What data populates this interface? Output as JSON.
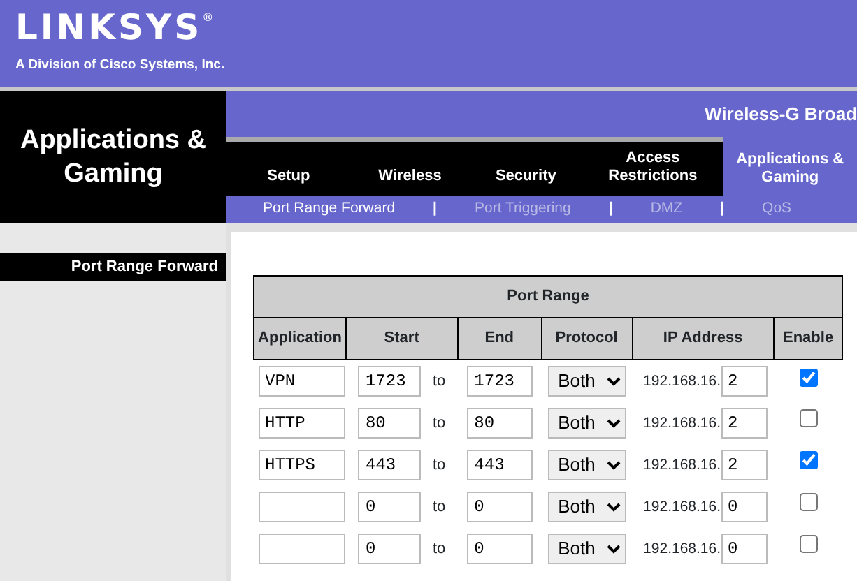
{
  "logo": {
    "wordmark": "LINKSYS",
    "registered": "®",
    "tagline": "A Division of Cisco Systems, Inc."
  },
  "section_title": "Applications & Gaming",
  "product_name": "Wireless-G Broad",
  "tabs": [
    {
      "label": "Setup",
      "selected": false
    },
    {
      "label": "Wireless",
      "selected": false
    },
    {
      "label": "Security",
      "selected": false
    },
    {
      "label": "Access Restrictions",
      "selected": false
    },
    {
      "label": "Applications & Gaming",
      "selected": true
    }
  ],
  "subtabs": [
    {
      "label": "Port Range Forward",
      "selected": true
    },
    {
      "label": "Port Triggering",
      "selected": false
    },
    {
      "label": "DMZ",
      "selected": false
    },
    {
      "label": "QoS",
      "selected": false
    }
  ],
  "separator": "|",
  "sidebar": {
    "label": "Port Range Forward"
  },
  "table": {
    "title": "Port Range",
    "columns": [
      "Application",
      "Start",
      "End",
      "Protocol",
      "IP Address",
      "Enable"
    ],
    "rows": [
      {
        "application": "VPN",
        "start": "1723",
        "to": "to",
        "end": "1723",
        "protocol": "Both",
        "ip_prefix": "192.168.16.",
        "ip_last": "2",
        "enabled": true
      },
      {
        "application": "HTTP",
        "start": "80",
        "to": "to",
        "end": "80",
        "protocol": "Both",
        "ip_prefix": "192.168.16.",
        "ip_last": "2",
        "enabled": false
      },
      {
        "application": "HTTPS",
        "start": "443",
        "to": "to",
        "end": "443",
        "protocol": "Both",
        "ip_prefix": "192.168.16.",
        "ip_last": "2",
        "enabled": true
      },
      {
        "application": "",
        "start": "0",
        "to": "to",
        "end": "0",
        "protocol": "Both",
        "ip_prefix": "192.168.16.",
        "ip_last": "0",
        "enabled": false
      },
      {
        "application": "",
        "start": "0",
        "to": "to",
        "end": "0",
        "protocol": "Both",
        "ip_prefix": "192.168.16.",
        "ip_last": "0",
        "enabled": false
      }
    ]
  }
}
